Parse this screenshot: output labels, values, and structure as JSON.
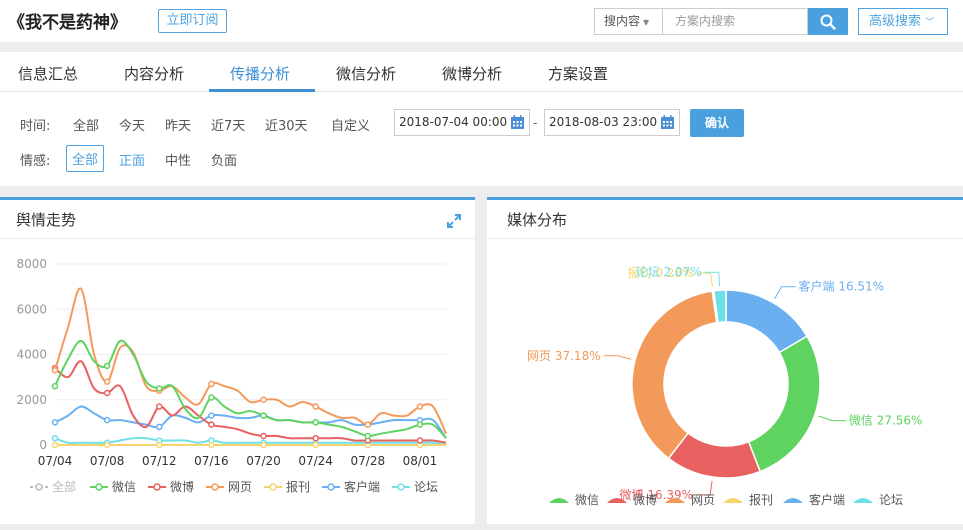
{
  "header": {
    "title": "《我不是药神》",
    "subscribe_label": "立即订阅",
    "search_type": "搜内容",
    "search_placeholder": "方案内搜索",
    "advanced_search_label": "高级搜索"
  },
  "tabs": [
    {
      "label": "信息汇总"
    },
    {
      "label": "内容分析"
    },
    {
      "label": "传播分析",
      "active": true
    },
    {
      "label": "微信分析"
    },
    {
      "label": "微博分析"
    },
    {
      "label": "方案设置"
    }
  ],
  "filters": {
    "time_label": "时间:",
    "time_options": [
      "全部",
      "今天",
      "昨天",
      "近7天",
      "近30天",
      "自定义"
    ],
    "date_from": "2018-07-04 00:00",
    "date_separator": "-",
    "date_to": "2018-08-03 23:00",
    "confirm_label": "确认",
    "sentiment_label": "情感:",
    "sentiment_options": [
      "全部",
      "正面",
      "中性",
      "负面"
    ],
    "sentiment_selected": "全部"
  },
  "colors": {
    "accent": "#4aa0de",
    "weixin": "#5fd35f",
    "weibo": "#e86060",
    "web": "#f39a5a",
    "paper": "#f5d56b",
    "client": "#6aaff0",
    "forum": "#6fe0e8",
    "all": "#bbbbbb"
  },
  "panels": {
    "trend_title": "舆情走势",
    "media_title": "媒体分布"
  },
  "chart_data": [
    {
      "type": "line",
      "title": "舆情走势",
      "x": [
        "07/04",
        "07/05",
        "07/06",
        "07/07",
        "07/08",
        "07/09",
        "07/10",
        "07/11",
        "07/12",
        "07/13",
        "07/14",
        "07/15",
        "07/16",
        "07/17",
        "07/18",
        "07/19",
        "07/20",
        "07/21",
        "07/22",
        "07/23",
        "07/24",
        "07/25",
        "07/26",
        "07/27",
        "07/28",
        "07/29",
        "07/30",
        "07/31",
        "08/01",
        "08/02",
        "08/03"
      ],
      "xticks": [
        "07/04",
        "07/08",
        "07/12",
        "07/16",
        "07/20",
        "07/24",
        "07/28",
        "08/01"
      ],
      "ylim": [
        0,
        8000
      ],
      "yticks": [
        0,
        2000,
        4000,
        6000,
        8000
      ],
      "legend": [
        "全部",
        "微信",
        "微博",
        "网页",
        "报刊",
        "客户端",
        "论坛"
      ],
      "series": [
        {
          "name": "微信",
          "values": [
            2600,
            3800,
            4600,
            3700,
            3500,
            4600,
            4000,
            2800,
            2500,
            2600,
            1600,
            1200,
            2100,
            1700,
            1400,
            1500,
            1300,
            1100,
            1100,
            1000,
            1000,
            900,
            800,
            600,
            400,
            500,
            600,
            700,
            900,
            900,
            300
          ]
        },
        {
          "name": "微博",
          "values": [
            3400,
            3000,
            3700,
            2500,
            2300,
            2600,
            1300,
            800,
            1700,
            1300,
            1700,
            1300,
            900,
            800,
            700,
            500,
            400,
            400,
            300,
            300,
            300,
            300,
            300,
            200,
            200,
            200,
            200,
            200,
            200,
            200,
            100
          ]
        },
        {
          "name": "网页",
          "values": [
            3300,
            5200,
            6900,
            4000,
            2800,
            4300,
            4100,
            2600,
            2400,
            2600,
            2100,
            1800,
            2700,
            2600,
            2400,
            1900,
            2000,
            2000,
            1700,
            1900,
            1700,
            1400,
            1200,
            1200,
            900,
            1400,
            1300,
            1300,
            1700,
            1700,
            500
          ]
        },
        {
          "name": "报刊",
          "values": [
            0,
            0,
            0,
            0,
            0,
            0,
            0,
            0,
            0,
            0,
            0,
            0,
            0,
            0,
            0,
            0,
            0,
            0,
            0,
            0,
            0,
            0,
            0,
            0,
            0,
            0,
            0,
            0,
            0,
            0,
            0
          ]
        },
        {
          "name": "客户端",
          "values": [
            1000,
            1300,
            1700,
            1400,
            1100,
            1100,
            1000,
            900,
            800,
            1300,
            1200,
            1000,
            1300,
            1300,
            1200,
            1200,
            1300,
            1100,
            1100,
            1000,
            1000,
            1000,
            1100,
            900,
            900,
            1000,
            1100,
            1100,
            1100,
            1100,
            300
          ]
        },
        {
          "name": "论坛",
          "values": [
            300,
            100,
            100,
            100,
            100,
            200,
            300,
            300,
            200,
            200,
            200,
            100,
            200,
            100,
            100,
            100,
            100,
            100,
            100,
            100,
            100,
            100,
            100,
            100,
            100,
            100,
            100,
            100,
            100,
            100,
            0
          ]
        }
      ]
    },
    {
      "type": "pie",
      "title": "媒体分布",
      "legend": [
        "微信",
        "微博",
        "网页",
        "报刊",
        "客户端",
        "论坛"
      ],
      "slices": [
        {
          "name": "客户端",
          "value": 16.51,
          "label": "客户端 16.51%"
        },
        {
          "name": "微信",
          "value": 27.56,
          "label": "微信 27.56%"
        },
        {
          "name": "微博",
          "value": 16.39,
          "label": "微博 16.39%"
        },
        {
          "name": "网页",
          "value": 37.18,
          "label": "网页 37.18%"
        },
        {
          "name": "报刊",
          "value": 0.28,
          "label": "报刊 0.28%"
        },
        {
          "name": "论坛",
          "value": 2.07,
          "label": "论坛 2.07%"
        }
      ]
    }
  ]
}
